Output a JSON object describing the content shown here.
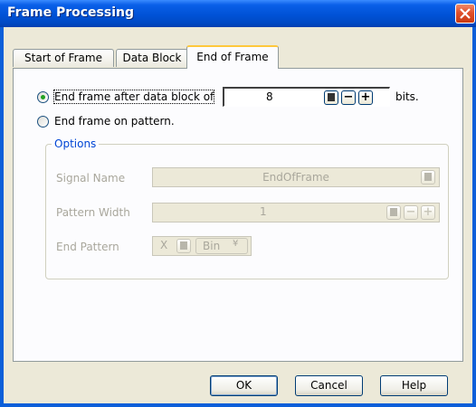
{
  "window": {
    "title": "Frame Processing"
  },
  "tabs": [
    {
      "label": "Start of Frame"
    },
    {
      "label": "Data Block"
    },
    {
      "label": "End of Frame"
    }
  ],
  "end_after": {
    "label": "End frame after data block of",
    "value": "8",
    "unit": "bits.",
    "selected": true
  },
  "end_pattern": {
    "label": "End frame on pattern.",
    "selected": false
  },
  "options": {
    "title": "Options",
    "signal_name": {
      "label": "Signal Name",
      "value": "EndOfFrame"
    },
    "pattern_width": {
      "label": "Pattern Width",
      "value": "1"
    },
    "end_pattern": {
      "label": "End Pattern",
      "value": "X",
      "format": "Bin"
    }
  },
  "buttons": {
    "ok": "OK",
    "cancel": "Cancel",
    "help": "Help"
  },
  "icons": {
    "calculator": "calculator-icon",
    "minus": "minus-icon",
    "plus": "plus-icon",
    "close": "close-icon",
    "chevron": "double-chevron-down-icon"
  },
  "colors": {
    "title_bar": "#0052d6",
    "group_title": "#0046d5",
    "radio_dot": "#21a121",
    "active_tab_accent": "#ffc83c"
  }
}
